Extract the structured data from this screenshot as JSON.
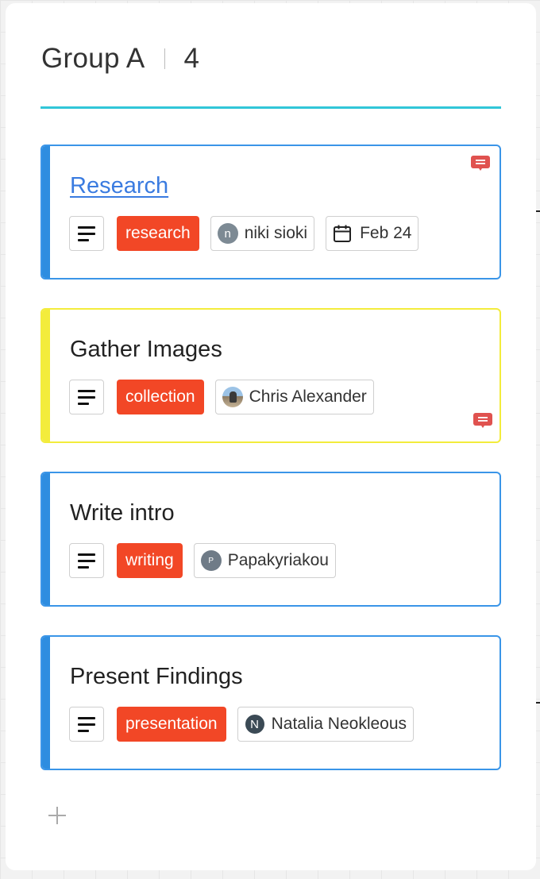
{
  "group": {
    "title": "Group A",
    "count": "4"
  },
  "cards": [
    {
      "title": "Research",
      "label": "research",
      "assignee": {
        "initial": "n",
        "name": "niki sioki"
      },
      "due": "Feb 24",
      "has_comment": true
    },
    {
      "title": "Gather Images",
      "label": "collection",
      "assignee": {
        "initial": "",
        "name": "Chris Alexander"
      },
      "has_comment": true
    },
    {
      "title": "Write intro",
      "label": "writing",
      "assignee": {
        "initial": "P",
        "name": "Papakyriakou"
      }
    },
    {
      "title": "Present Findings",
      "label": "presentation",
      "assignee": {
        "initial": "N",
        "name": "Natalia Neokleous"
      }
    }
  ],
  "colors": {
    "accent_rule": "#31c6d8",
    "card_blue": "#2e8de0",
    "card_yellow": "#f3ec3c",
    "label_red": "#f24726",
    "comment_red": "#e0524f"
  },
  "icons": [
    "description-icon",
    "calendar-icon",
    "comment-icon",
    "plus-icon"
  ]
}
